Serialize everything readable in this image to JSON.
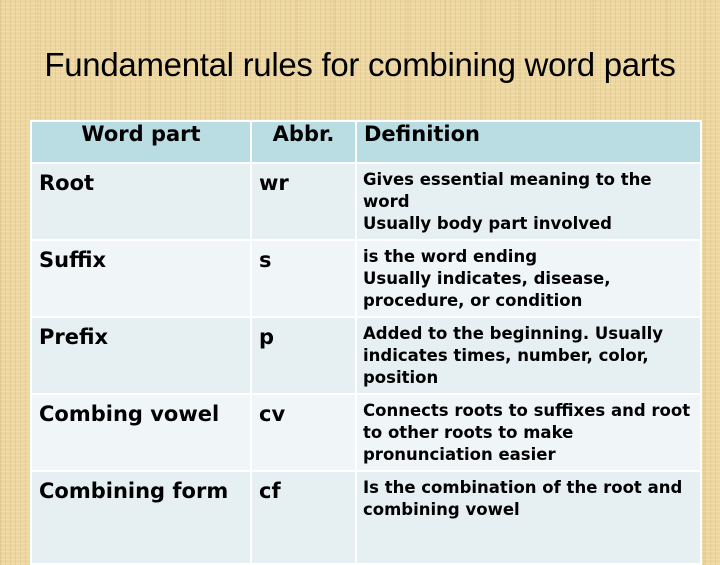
{
  "title": "Fundamental rules for combining word parts",
  "table": {
    "headers": [
      "Word part",
      "Abbr.",
      "Definition"
    ],
    "rows": [
      {
        "word_part": "Root",
        "abbr": "wr",
        "definition": [
          "Gives essential meaning to the word",
          "Usually body part involved"
        ]
      },
      {
        "word_part": "Suffix",
        "abbr": "s",
        "definition": [
          "is the word ending",
          "Usually indicates, disease, procedure, or condition"
        ]
      },
      {
        "word_part": "Prefix",
        "abbr": "p",
        "definition": [
          "Added to the beginning. Usually indicates times, number, color, position"
        ]
      },
      {
        "word_part": "Combing vowel",
        "abbr": "cv",
        "definition": [
          "Connects roots to suffixes and root to other roots to make pronunciation easier"
        ]
      },
      {
        "word_part": "Combining form",
        "abbr": "cf",
        "definition": [
          "Is the combination of the root and combining vowel"
        ]
      }
    ]
  },
  "colors": {
    "background": "#ecd6a2",
    "header_bg": "#b9dde2",
    "row_bg_odd": "#e6f0f3",
    "row_bg_even": "#f0f6f8",
    "border": "#ffffff"
  }
}
